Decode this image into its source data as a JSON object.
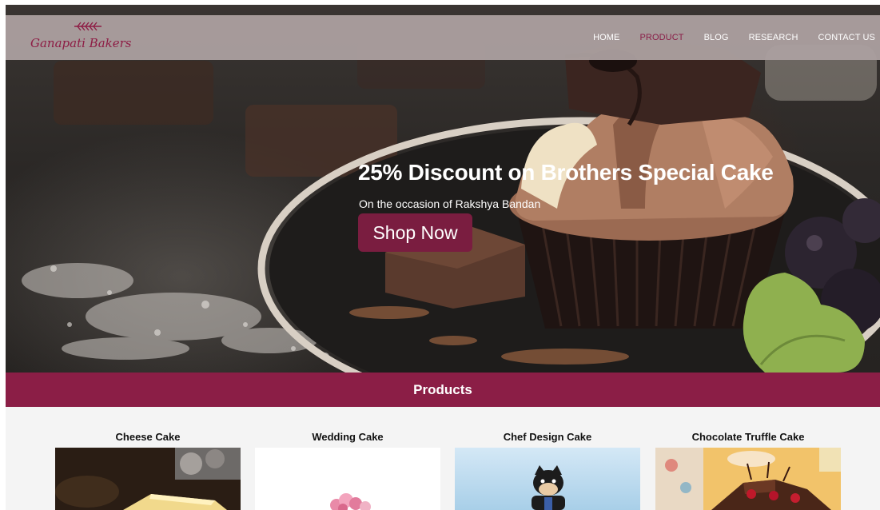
{
  "brand": {
    "name": "Ganapati Bakers",
    "accent": "#8e1d45"
  },
  "nav": {
    "items": [
      {
        "label": "HOME",
        "active": false
      },
      {
        "label": "PRODUCT",
        "active": true
      },
      {
        "label": "BLOG",
        "active": false
      },
      {
        "label": "RESEARCH",
        "active": false
      },
      {
        "label": "CONTACT US",
        "active": false
      }
    ]
  },
  "hero": {
    "title": "25% Discount on Brothers Special Cake",
    "subtitle": "On the occasion of Rakshya Bandan",
    "button_label": "Shop Now",
    "button_color": "#7a1d40"
  },
  "products": {
    "heading": "Products",
    "bar_color": "#8b1e46",
    "items": [
      {
        "name": "Cheese Cake"
      },
      {
        "name": "Wedding Cake"
      },
      {
        "name": "Chef Design Cake"
      },
      {
        "name": "Chocolate Truffle Cake"
      }
    ]
  }
}
